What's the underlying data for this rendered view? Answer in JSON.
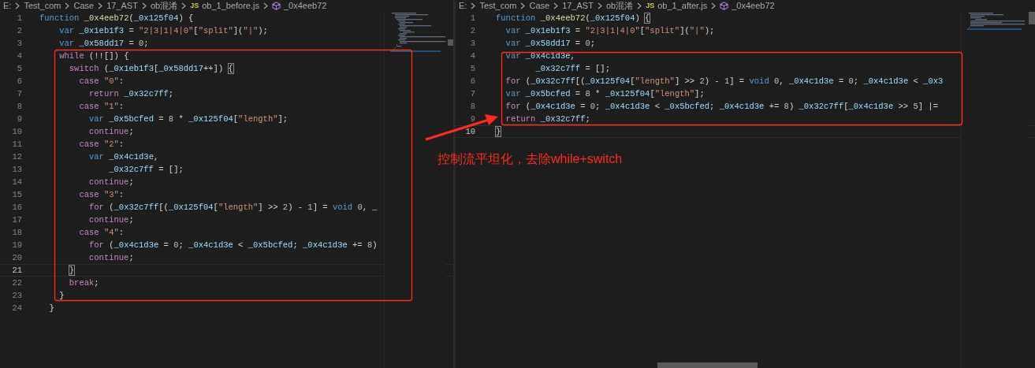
{
  "panes": [
    {
      "breadcrumb": {
        "path": [
          "E:",
          "Test_com",
          "Case",
          "17_AST",
          "ob混淆"
        ],
        "file_badge": "JS",
        "file": "ob_1_before.js",
        "symbol": "_0x4eeb72"
      },
      "lines": [
        {
          "number": "1",
          "current": false,
          "tokens": [
            {
              "kind": "keyword",
              "text": "function"
            },
            {
              "kind": "function",
              "text": " _0x4eeb72"
            },
            {
              "kind": "plain",
              "text": "("
            },
            {
              "kind": "ident",
              "text": "_0x125f04"
            },
            {
              "kind": "plain",
              "text": ") {"
            }
          ]
        },
        {
          "number": "2",
          "current": false,
          "tokens": [
            {
              "kind": "keyword",
              "text": "    var"
            },
            {
              "kind": "ident",
              "text": " _0x1eb1f3"
            },
            {
              "kind": "plain",
              "text": " = "
            },
            {
              "kind": "string",
              "text": "\"2|3|1|4|0\""
            },
            {
              "kind": "plain",
              "text": "["
            },
            {
              "kind": "string",
              "text": "\"split\""
            },
            {
              "kind": "plain",
              "text": "]("
            },
            {
              "kind": "string",
              "text": "\"|\""
            },
            {
              "kind": "plain",
              "text": ");"
            }
          ]
        },
        {
          "number": "3",
          "current": false,
          "tokens": [
            {
              "kind": "keyword",
              "text": "    var"
            },
            {
              "kind": "ident",
              "text": " _0x58dd17"
            },
            {
              "kind": "plain",
              "text": " = "
            },
            {
              "kind": "number",
              "text": "0"
            },
            {
              "kind": "plain",
              "text": ";"
            }
          ]
        },
        {
          "number": "4",
          "current": false,
          "tokens": [
            {
              "kind": "control",
              "text": "    while"
            },
            {
              "kind": "plain",
              "text": " (!![]) {"
            }
          ]
        },
        {
          "number": "5",
          "current": false,
          "tokens": [
            {
              "kind": "control",
              "text": "      switch"
            },
            {
              "kind": "plain",
              "text": " ("
            },
            {
              "kind": "ident",
              "text": "_0x1eb1f3"
            },
            {
              "kind": "plain",
              "text": "["
            },
            {
              "kind": "ident",
              "text": "_0x58dd17"
            },
            {
              "kind": "plain",
              "text": "++])"
            },
            {
              "kind": "brace",
              "text": " {"
            }
          ]
        },
        {
          "number": "6",
          "current": false,
          "tokens": [
            {
              "kind": "control",
              "text": "        case"
            },
            {
              "kind": "string",
              "text": " \"0\""
            },
            {
              "kind": "plain",
              "text": ":"
            }
          ]
        },
        {
          "number": "7",
          "current": false,
          "tokens": [
            {
              "kind": "control",
              "text": "          return"
            },
            {
              "kind": "ident",
              "text": " _0x32c7ff"
            },
            {
              "kind": "plain",
              "text": ";"
            }
          ]
        },
        {
          "number": "8",
          "current": false,
          "tokens": [
            {
              "kind": "control",
              "text": "        case"
            },
            {
              "kind": "string",
              "text": " \"1\""
            },
            {
              "kind": "plain",
              "text": ":"
            }
          ]
        },
        {
          "number": "9",
          "current": false,
          "tokens": [
            {
              "kind": "keyword",
              "text": "          var"
            },
            {
              "kind": "ident",
              "text": " _0x5bcfed"
            },
            {
              "kind": "plain",
              "text": " = "
            },
            {
              "kind": "number",
              "text": "8"
            },
            {
              "kind": "plain",
              "text": " * "
            },
            {
              "kind": "ident",
              "text": "_0x125f04"
            },
            {
              "kind": "plain",
              "text": "["
            },
            {
              "kind": "string",
              "text": "\"length\""
            },
            {
              "kind": "plain",
              "text": "];"
            }
          ]
        },
        {
          "number": "10",
          "current": false,
          "tokens": [
            {
              "kind": "control",
              "text": "          continue"
            },
            {
              "kind": "plain",
              "text": ";"
            }
          ]
        },
        {
          "number": "11",
          "current": false,
          "tokens": [
            {
              "kind": "control",
              "text": "        case"
            },
            {
              "kind": "string",
              "text": " \"2\""
            },
            {
              "kind": "plain",
              "text": ":"
            }
          ]
        },
        {
          "number": "12",
          "current": false,
          "tokens": [
            {
              "kind": "keyword",
              "text": "          var"
            },
            {
              "kind": "ident",
              "text": " _0x4c1d3e"
            },
            {
              "kind": "plain",
              "text": ","
            }
          ]
        },
        {
          "number": "13",
          "current": false,
          "tokens": [
            {
              "kind": "ident",
              "text": "              _0x32c7ff"
            },
            {
              "kind": "plain",
              "text": " = [];"
            }
          ]
        },
        {
          "number": "14",
          "current": false,
          "tokens": [
            {
              "kind": "control",
              "text": "          continue"
            },
            {
              "kind": "plain",
              "text": ";"
            }
          ]
        },
        {
          "number": "15",
          "current": false,
          "tokens": [
            {
              "kind": "control",
              "text": "        case"
            },
            {
              "kind": "string",
              "text": " \"3\""
            },
            {
              "kind": "plain",
              "text": ":"
            }
          ]
        },
        {
          "number": "16",
          "current": false,
          "tokens": [
            {
              "kind": "control",
              "text": "          for"
            },
            {
              "kind": "plain",
              "text": " ("
            },
            {
              "kind": "ident",
              "text": "_0x32c7ff"
            },
            {
              "kind": "plain",
              "text": "[("
            },
            {
              "kind": "ident",
              "text": "_0x125f04"
            },
            {
              "kind": "plain",
              "text": "["
            },
            {
              "kind": "string",
              "text": "\"length\""
            },
            {
              "kind": "plain",
              "text": "] >> "
            },
            {
              "kind": "number",
              "text": "2"
            },
            {
              "kind": "plain",
              "text": ") - "
            },
            {
              "kind": "number",
              "text": "1"
            },
            {
              "kind": "plain",
              "text": "] = "
            },
            {
              "kind": "keyword",
              "text": "void"
            },
            {
              "kind": "number",
              "text": " 0"
            },
            {
              "kind": "plain",
              "text": ", "
            },
            {
              "kind": "ident",
              "text": "_"
            }
          ]
        },
        {
          "number": "17",
          "current": false,
          "tokens": [
            {
              "kind": "control",
              "text": "          continue"
            },
            {
              "kind": "plain",
              "text": ";"
            }
          ]
        },
        {
          "number": "18",
          "current": false,
          "tokens": [
            {
              "kind": "control",
              "text": "        case"
            },
            {
              "kind": "string",
              "text": " \"4\""
            },
            {
              "kind": "plain",
              "text": ":"
            }
          ]
        },
        {
          "number": "19",
          "current": false,
          "tokens": [
            {
              "kind": "control",
              "text": "          for"
            },
            {
              "kind": "plain",
              "text": " ("
            },
            {
              "kind": "ident",
              "text": "_0x4c1d3e"
            },
            {
              "kind": "plain",
              "text": " = "
            },
            {
              "kind": "number",
              "text": "0"
            },
            {
              "kind": "plain",
              "text": "; "
            },
            {
              "kind": "ident",
              "text": "_0x4c1d3e"
            },
            {
              "kind": "plain",
              "text": " < "
            },
            {
              "kind": "ident",
              "text": "_0x5bcfed"
            },
            {
              "kind": "plain",
              "text": "; "
            },
            {
              "kind": "ident",
              "text": "_0x4c1d3e"
            },
            {
              "kind": "plain",
              "text": " += "
            },
            {
              "kind": "number",
              "text": "8"
            },
            {
              "kind": "plain",
              "text": ")"
            }
          ]
        },
        {
          "number": "20",
          "current": false,
          "tokens": [
            {
              "kind": "control",
              "text": "          continue"
            },
            {
              "kind": "plain",
              "text": ";"
            }
          ]
        },
        {
          "number": "21",
          "current": true,
          "tokens": [
            {
              "kind": "brace",
              "text": "      }"
            }
          ]
        },
        {
          "number": "22",
          "current": false,
          "tokens": [
            {
              "kind": "control",
              "text": "      break"
            },
            {
              "kind": "plain",
              "text": ";"
            }
          ]
        },
        {
          "number": "23",
          "current": false,
          "tokens": [
            {
              "kind": "plain",
              "text": "    }"
            }
          ]
        },
        {
          "number": "24",
          "current": false,
          "tokens": [
            {
              "kind": "plain",
              "text": "  }"
            }
          ]
        }
      ]
    },
    {
      "breadcrumb": {
        "path": [
          "E:",
          "Test_com",
          "Case",
          "17_AST",
          "ob混淆"
        ],
        "file_badge": "JS",
        "file": "ob_1_after.js",
        "symbol": "_0x4eeb72"
      },
      "lines": [
        {
          "number": "1",
          "current": false,
          "tokens": [
            {
              "kind": "keyword",
              "text": "function"
            },
            {
              "kind": "function",
              "text": " _0x4eeb72"
            },
            {
              "kind": "plain",
              "text": "("
            },
            {
              "kind": "ident",
              "text": "_0x125f04"
            },
            {
              "kind": "plain",
              "text": ")"
            },
            {
              "kind": "brace",
              "text": " {"
            }
          ]
        },
        {
          "number": "2",
          "current": false,
          "tokens": [
            {
              "kind": "keyword",
              "text": "  var"
            },
            {
              "kind": "ident",
              "text": " _0x1eb1f3"
            },
            {
              "kind": "plain",
              "text": " = "
            },
            {
              "kind": "string",
              "text": "\"2|3|1|4|0\""
            },
            {
              "kind": "plain",
              "text": "["
            },
            {
              "kind": "string",
              "text": "\"split\""
            },
            {
              "kind": "plain",
              "text": "]("
            },
            {
              "kind": "string",
              "text": "\"|\""
            },
            {
              "kind": "plain",
              "text": ");"
            }
          ]
        },
        {
          "number": "3",
          "current": false,
          "tokens": [
            {
              "kind": "keyword",
              "text": "  var"
            },
            {
              "kind": "ident",
              "text": " _0x58dd17"
            },
            {
              "kind": "plain",
              "text": " = "
            },
            {
              "kind": "number",
              "text": "0"
            },
            {
              "kind": "plain",
              "text": ";"
            }
          ]
        },
        {
          "number": "4",
          "current": false,
          "tokens": [
            {
              "kind": "keyword",
              "text": "  var"
            },
            {
              "kind": "ident",
              "text": " _0x4c1d3e"
            },
            {
              "kind": "plain",
              "text": ","
            }
          ]
        },
        {
          "number": "5",
          "current": false,
          "tokens": [
            {
              "kind": "ident",
              "text": "        _0x32c7ff"
            },
            {
              "kind": "plain",
              "text": " = [];"
            }
          ]
        },
        {
          "number": "6",
          "current": false,
          "tokens": [
            {
              "kind": "control",
              "text": "  for"
            },
            {
              "kind": "plain",
              "text": " ("
            },
            {
              "kind": "ident",
              "text": "_0x32c7ff"
            },
            {
              "kind": "plain",
              "text": "[("
            },
            {
              "kind": "ident",
              "text": "_0x125f04"
            },
            {
              "kind": "plain",
              "text": "["
            },
            {
              "kind": "string",
              "text": "\"length\""
            },
            {
              "kind": "plain",
              "text": "] >> "
            },
            {
              "kind": "number",
              "text": "2"
            },
            {
              "kind": "plain",
              "text": ") - "
            },
            {
              "kind": "number",
              "text": "1"
            },
            {
              "kind": "plain",
              "text": "] = "
            },
            {
              "kind": "keyword",
              "text": "void"
            },
            {
              "kind": "number",
              "text": " 0"
            },
            {
              "kind": "plain",
              "text": ", "
            },
            {
              "kind": "ident",
              "text": "_0x4c1d3e"
            },
            {
              "kind": "plain",
              "text": " = "
            },
            {
              "kind": "number",
              "text": "0"
            },
            {
              "kind": "plain",
              "text": "; "
            },
            {
              "kind": "ident",
              "text": "_0x4c1d3e"
            },
            {
              "kind": "plain",
              "text": " < "
            },
            {
              "kind": "ident",
              "text": "_0x3"
            }
          ]
        },
        {
          "number": "7",
          "current": false,
          "tokens": [
            {
              "kind": "keyword",
              "text": "  var"
            },
            {
              "kind": "ident",
              "text": " _0x5bcfed"
            },
            {
              "kind": "plain",
              "text": " = "
            },
            {
              "kind": "number",
              "text": "8"
            },
            {
              "kind": "plain",
              "text": " * "
            },
            {
              "kind": "ident",
              "text": "_0x125f04"
            },
            {
              "kind": "plain",
              "text": "["
            },
            {
              "kind": "string",
              "text": "\"length\""
            },
            {
              "kind": "plain",
              "text": "];"
            }
          ]
        },
        {
          "number": "8",
          "current": false,
          "tokens": [
            {
              "kind": "control",
              "text": "  for"
            },
            {
              "kind": "plain",
              "text": " ("
            },
            {
              "kind": "ident",
              "text": "_0x4c1d3e"
            },
            {
              "kind": "plain",
              "text": " = "
            },
            {
              "kind": "number",
              "text": "0"
            },
            {
              "kind": "plain",
              "text": "; "
            },
            {
              "kind": "ident",
              "text": "_0x4c1d3e"
            },
            {
              "kind": "plain",
              "text": " < "
            },
            {
              "kind": "ident",
              "text": "_0x5bcfed"
            },
            {
              "kind": "plain",
              "text": "; "
            },
            {
              "kind": "ident",
              "text": "_0x4c1d3e"
            },
            {
              "kind": "plain",
              "text": " += "
            },
            {
              "kind": "number",
              "text": "8"
            },
            {
              "kind": "plain",
              "text": ") "
            },
            {
              "kind": "ident",
              "text": "_0x32c7ff"
            },
            {
              "kind": "plain",
              "text": "["
            },
            {
              "kind": "ident",
              "text": "_0x4c1d3e"
            },
            {
              "kind": "plain",
              "text": " >> "
            },
            {
              "kind": "number",
              "text": "5"
            },
            {
              "kind": "plain",
              "text": "] |="
            }
          ]
        },
        {
          "number": "9",
          "current": false,
          "tokens": [
            {
              "kind": "control",
              "text": "  return"
            },
            {
              "kind": "ident",
              "text": " _0x32c7ff"
            },
            {
              "kind": "plain",
              "text": ";"
            }
          ]
        },
        {
          "number": "10",
          "current": true,
          "tokens": [
            {
              "kind": "brace",
              "text": "}"
            }
          ]
        }
      ]
    }
  ],
  "annotation": {
    "text": "控制流平坦化，去除while+switch"
  }
}
